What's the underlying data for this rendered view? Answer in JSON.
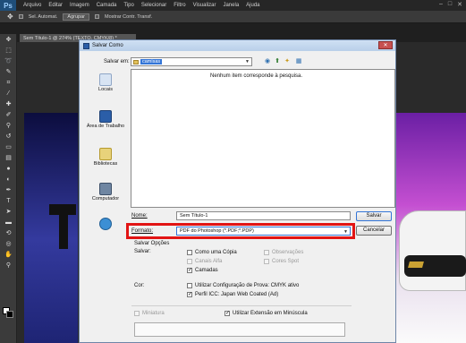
{
  "app": {
    "logo": "Ps",
    "menu": [
      "Arquivo",
      "Editar",
      "Imagem",
      "Camada",
      "Tipo",
      "Selecionar",
      "Filtro",
      "Visualizar",
      "Janela",
      "Ajuda"
    ],
    "options": {
      "auto_select": "Sel. Automat.",
      "group": "Agrupar",
      "show_transform": "Mostrar Contr. Transf."
    },
    "doc_tab": "Sem Título-1 @ 274% (TEXTO, CMYK/8) *"
  },
  "dialog": {
    "title": "Salvar Como",
    "save_in_label": "Salvar em:",
    "save_in_value": "camisas",
    "empty_message": "Nenhum item corresponde à pesquisa.",
    "places": [
      "Locais",
      "Área de Trabalho",
      "Bibliotecas",
      "Computador"
    ],
    "name_label": "Nome:",
    "name_value": "Sem Título-1",
    "format_label": "Formato:",
    "format_value": "PDF do Photoshop (*.PDF;*.PDP)",
    "save_button": "Salvar",
    "cancel_button": "Cancelar",
    "save_options_title": "Salvar Opções",
    "save_label": "Salvar:",
    "opt_as_copy": "Como uma Cópia",
    "opt_alpha": "Canais Alfa",
    "opt_layers": "Camadas",
    "opt_notes": "Observações",
    "opt_spot": "Cores Spot",
    "color_label": "Cor:",
    "opt_proof": "Utilizar Configuração de Prova: CMYK ativo",
    "opt_icc": "Perfil ICC: Japan Web Coated (Ad)",
    "opt_thumbnail": "Miniatura",
    "opt_lowercase": "Utilizar Extensão em Minúscula"
  }
}
